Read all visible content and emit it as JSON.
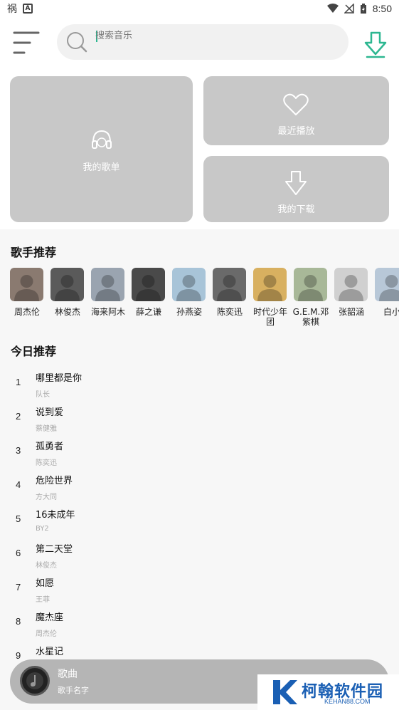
{
  "status_bar": {
    "time": "8:50"
  },
  "search": {
    "placeholder": "搜索音乐"
  },
  "cards": {
    "my_playlist": "我的歌单",
    "recent": "最近播放",
    "downloads": "我的下载"
  },
  "singers_section": {
    "title": "歌手推荐",
    "items": [
      {
        "name": "周杰伦",
        "color": "#8a7a70"
      },
      {
        "name": "林俊杰",
        "color": "#5a5a5a"
      },
      {
        "name": "海来阿木",
        "color": "#9aa4b0"
      },
      {
        "name": "薛之谦",
        "color": "#4a4a4a"
      },
      {
        "name": "孙燕姿",
        "color": "#a8c4d8"
      },
      {
        "name": "陈奕迅",
        "color": "#6a6a6a"
      },
      {
        "name": "时代少年团",
        "color": "#d8b060"
      },
      {
        "name": "G.E.M.邓紫棋",
        "color": "#a8b898"
      },
      {
        "name": "张韶涵",
        "color": "#d0d0d0"
      },
      {
        "name": "白小",
        "color": "#b8c8d8"
      }
    ]
  },
  "today_section": {
    "title": "今日推荐",
    "songs": [
      {
        "index": "1",
        "title": "哪里都是你",
        "artist": "队长"
      },
      {
        "index": "2",
        "title": "说到爱",
        "artist": "蔡健雅"
      },
      {
        "index": "3",
        "title": "孤勇者",
        "artist": "陈奕迅"
      },
      {
        "index": "4",
        "title": "危险世界",
        "artist": "方大同"
      },
      {
        "index": "5",
        "title": "16未成年",
        "artist": "BY2"
      },
      {
        "index": "6",
        "title": "第二天堂",
        "artist": "林俊杰"
      },
      {
        "index": "7",
        "title": "如愿",
        "artist": "王菲"
      },
      {
        "index": "8",
        "title": "魔杰座",
        "artist": "周杰伦"
      },
      {
        "index": "9",
        "title": "水星记",
        "artist": ""
      }
    ]
  },
  "player": {
    "title": "歌曲",
    "artist": "歌手名字"
  },
  "watermark": {
    "title": "柯翰软件园",
    "url": "KEHAN88.COM"
  },
  "colors": {
    "accent": "#2db791",
    "card": "#c8c8c8",
    "player": "#b5b5b5",
    "watermark": "#1a5fb4"
  }
}
